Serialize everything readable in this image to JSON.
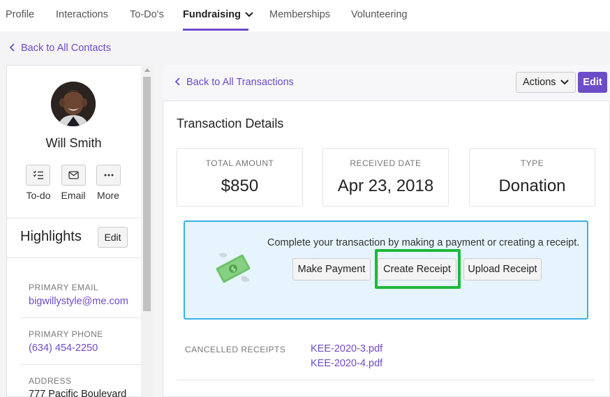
{
  "nav": {
    "tabs": [
      {
        "label": "Profile"
      },
      {
        "label": "Interactions"
      },
      {
        "label": "To-Do's"
      },
      {
        "label": "Fundraising"
      },
      {
        "label": "Memberships"
      },
      {
        "label": "Volunteering"
      }
    ],
    "active_tab": "Fundraising"
  },
  "back_to_contacts": "Back to All Contacts",
  "contact": {
    "name": "Will Smith",
    "actions": [
      {
        "label": "To-do",
        "icon": "checklist-icon"
      },
      {
        "label": "Email",
        "icon": "envelope-icon"
      },
      {
        "label": "More",
        "icon": "ellipsis-icon"
      }
    ]
  },
  "highlights": {
    "title": "Highlights",
    "edit_label": "Edit",
    "fields": [
      {
        "label": "PRIMARY EMAIL",
        "value": "bigwillystyle@me.com"
      },
      {
        "label": "PRIMARY PHONE",
        "value": "(634) 454-2250"
      },
      {
        "label": "ADDRESS",
        "value": "777 Pacific Boulevard"
      }
    ]
  },
  "transaction": {
    "back_label": "Back to All Transactions",
    "actions_label": "Actions",
    "edit_label": "Edit",
    "title": "Transaction Details",
    "stats": [
      {
        "label": "TOTAL AMOUNT",
        "value": "$850"
      },
      {
        "label": "RECEIVED DATE",
        "value": "Apr 23, 2018"
      },
      {
        "label": "TYPE",
        "value": "Donation"
      }
    ],
    "callout": {
      "message": "Complete your transaction by making a payment or creating a receipt.",
      "buttons": [
        "Make Payment",
        "Create Receipt",
        "Upload Receipt"
      ]
    },
    "cancelled_receipts_label": "CANCELLED RECEIPTS",
    "cancelled_receipts": [
      "KEE-2020-3.pdf",
      "KEE-2020-4.pdf"
    ]
  },
  "colors": {
    "accent": "#6c4cc8",
    "callout_bg": "#e6f5fd",
    "callout_border": "#3ab0e6",
    "highlight_green": "#1fb83c"
  }
}
